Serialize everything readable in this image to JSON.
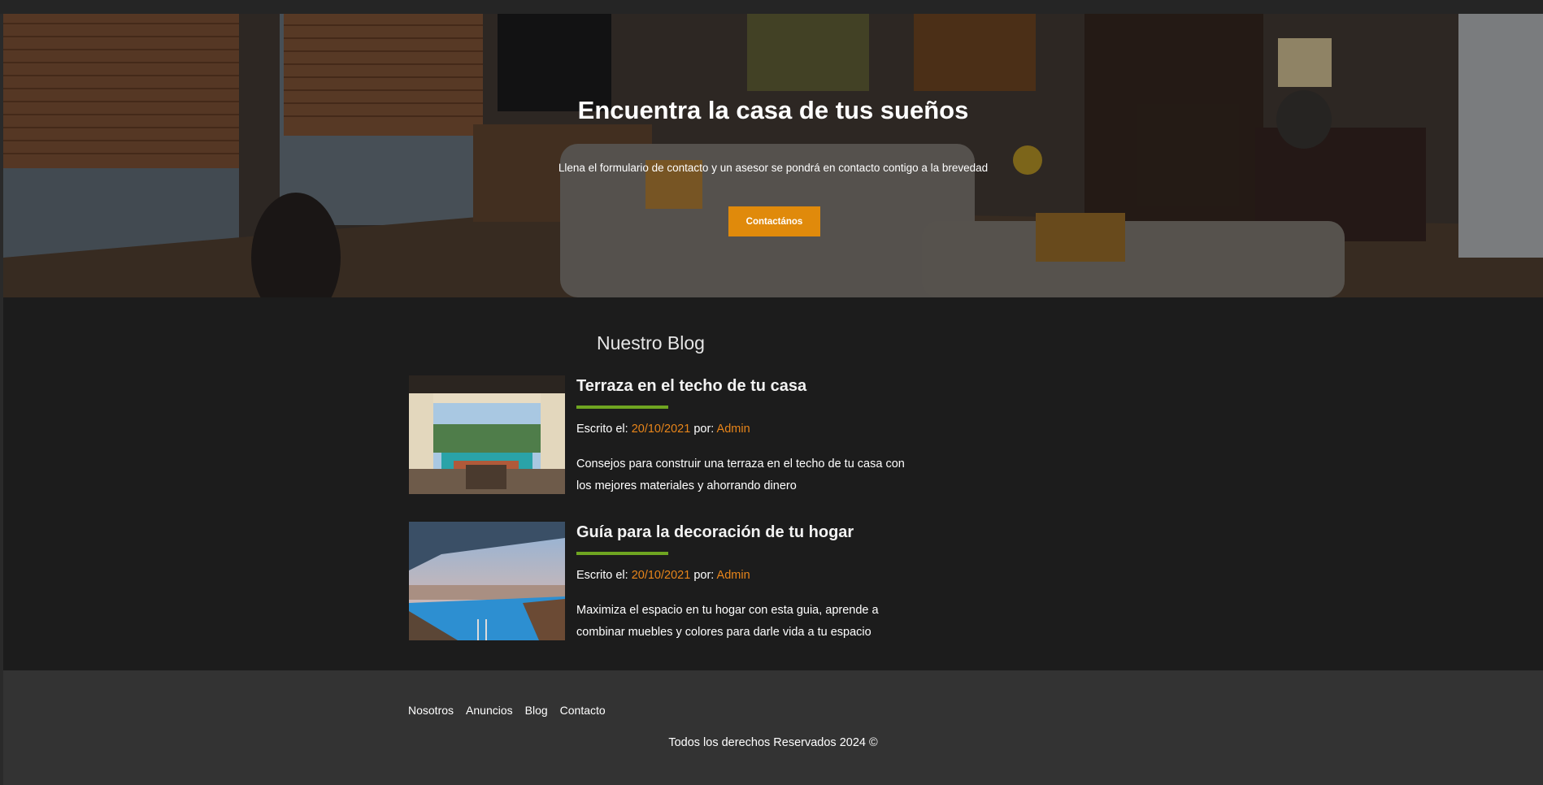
{
  "hero": {
    "title": "Encuentra la casa de tus sueños",
    "subtitle": "Llena el formulario de contacto y un asesor se pondrá en contacto contigo a la brevedad",
    "button_label": "Contactános"
  },
  "blog": {
    "heading": "Nuestro Blog",
    "posts": [
      {
        "title": "Terraza en el techo de tu casa",
        "written_label": "Escrito el:",
        "date": "20/10/2021",
        "by_label": "por:",
        "author": "Admin",
        "excerpt": "Consejos para construir una terraza en el techo de tu casa con los mejores materiales y ahorrando dinero"
      },
      {
        "title": "Guía para la decoración de tu hogar",
        "written_label": "Escrito el:",
        "date": "20/10/2021",
        "by_label": "por:",
        "author": "Admin",
        "excerpt": "Maximiza el espacio en tu hogar con esta guia, aprende a combinar muebles y colores para darle vida a tu espacio"
      }
    ]
  },
  "footer": {
    "nav": [
      "Nosotros",
      "Anuncios",
      "Blog",
      "Contacto"
    ],
    "copyright": "Todos los derechos Reservados 2024 ©"
  },
  "colors": {
    "accent": "#e08a0b",
    "underline": "#6fa521",
    "link": "#e8851a",
    "section_bg": "#1c1c1c",
    "footer_bg": "#333333"
  }
}
